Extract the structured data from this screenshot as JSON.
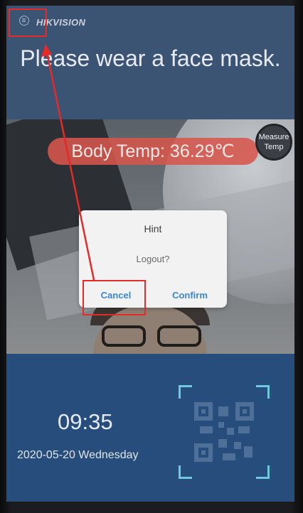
{
  "header": {
    "brand": "HIKVISION",
    "menu_icon": "menu-circle-icon"
  },
  "main": {
    "prompt": "Please wear a face mask.",
    "body_temp": "Body Temp: 36.29℃",
    "measure_temp": {
      "line1": "Measure",
      "line2": "Temp"
    }
  },
  "dialog": {
    "title": "Hint",
    "message": "Logout?",
    "cancel_label": "Cancel",
    "confirm_label": "Confirm"
  },
  "footer": {
    "time": "09:35",
    "date": "2020-05-20 Wednesday",
    "qr_icon": "qr-code-icon"
  },
  "colors": {
    "screen_bg": "#3c5474",
    "footer_bg": "#264d7c",
    "temp_pill": "#d6564c",
    "dialog_button": "#3b86d6",
    "annotation": "#e52a2a"
  }
}
